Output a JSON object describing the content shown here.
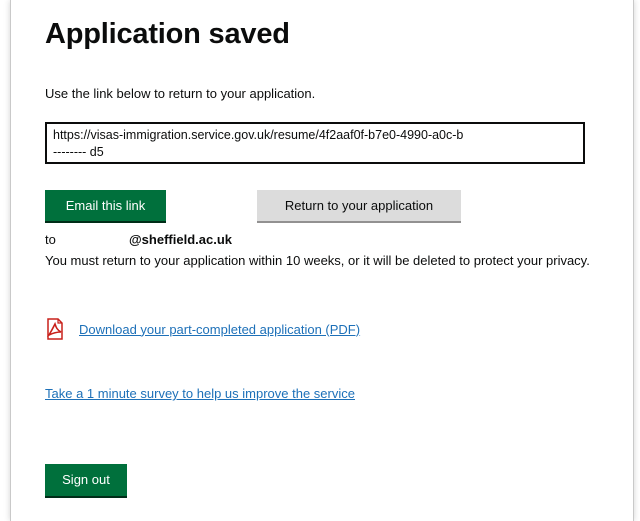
{
  "page": {
    "title": "Application saved",
    "intro": "Use the link below to return to your application."
  },
  "resume_link": {
    "line1": "https://visas-immigration.service.gov.uk/resume/4f2aaf0f-b7e0-4990-a0c-b",
    "line2": "--------  d5"
  },
  "buttons": {
    "email_label": "Email this link",
    "return_label": "Return to your application",
    "signout_label": "Sign out"
  },
  "email": {
    "to_label": "to",
    "domain": "@sheffield.ac.uk"
  },
  "notice": "You must return to your application within 10 weeks, or it will be deleted to protect your privacy.",
  "links": {
    "pdf_download": "Download your part-completed application (PDF)",
    "survey": "Take a 1 minute survey to help us improve the service"
  },
  "icons": {
    "pdf": "pdf-file-icon"
  },
  "colors": {
    "primary_button": "#00703c",
    "secondary_button": "#dcdcdc",
    "link": "#1d70b8",
    "text": "#0b0c0c",
    "pdf_icon": "#c8201a"
  }
}
